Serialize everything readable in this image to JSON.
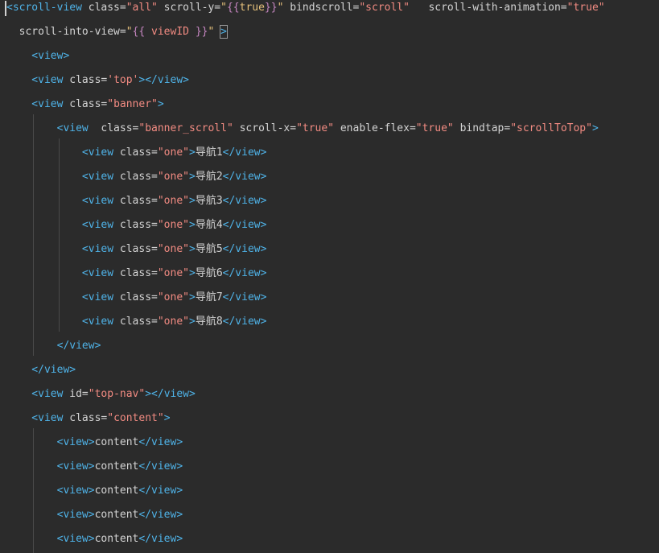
{
  "theme": {
    "background": "#2b2b2b",
    "tag": "#4fb3e8",
    "attribute": "#d4d4d4",
    "string": "#e5c07b",
    "string_value": "#f28b82",
    "text": "#d4d4d4",
    "moustache": "#c586c0",
    "guide": "#4a4a4a"
  },
  "code_lines": [
    [
      {
        "t": "<",
        "c": "tag"
      },
      {
        "t": "scroll-view",
        "c": "tag"
      },
      {
        "t": " class=",
        "c": "attribute"
      },
      {
        "t": "\"all\"",
        "c": "string_value"
      },
      {
        "t": " scroll-y=",
        "c": "attribute"
      },
      {
        "t": "\"",
        "c": "string"
      },
      {
        "t": "{{",
        "c": "moustache"
      },
      {
        "t": "true",
        "c": "string"
      },
      {
        "t": "}}",
        "c": "moustache"
      },
      {
        "t": "\"",
        "c": "string"
      },
      {
        "t": " bindscroll=",
        "c": "attribute"
      },
      {
        "t": "\"scroll\"",
        "c": "string_value"
      },
      {
        "t": "   scroll-with-animation=",
        "c": "attribute"
      },
      {
        "t": "\"true\"",
        "c": "string_value"
      }
    ],
    [
      {
        "t": "  scroll-into-view=",
        "c": "attribute"
      },
      {
        "t": "\"",
        "c": "string"
      },
      {
        "t": "{{",
        "c": "moustache"
      },
      {
        "t": " viewID ",
        "c": "string_value"
      },
      {
        "t": "}}",
        "c": "moustache"
      },
      {
        "t": "\"",
        "c": "string"
      },
      {
        "t": " ",
        "c": "attribute"
      },
      {
        "t": ">",
        "c": "tag",
        "box": true
      }
    ],
    [
      {
        "t": "    <view>",
        "c": "tag"
      }
    ],
    [
      {
        "t": "    <view",
        "c": "tag"
      },
      {
        "t": " class=",
        "c": "attribute"
      },
      {
        "t": "'top'",
        "c": "string_value"
      },
      {
        "t": "></view>",
        "c": "tag"
      }
    ],
    [
      {
        "t": "    <view",
        "c": "tag"
      },
      {
        "t": " class=",
        "c": "attribute"
      },
      {
        "t": "\"banner\"",
        "c": "string_value"
      },
      {
        "t": ">",
        "c": "tag"
      }
    ],
    [
      {
        "t": "        <view",
        "c": "tag"
      },
      {
        "t": "  class=",
        "c": "attribute"
      },
      {
        "t": "\"banner_scroll\"",
        "c": "string_value"
      },
      {
        "t": " scroll-x=",
        "c": "attribute"
      },
      {
        "t": "\"true\"",
        "c": "string_value"
      },
      {
        "t": " enable-flex=",
        "c": "attribute"
      },
      {
        "t": "\"true\"",
        "c": "string_value"
      },
      {
        "t": " bindtap=",
        "c": "attribute"
      },
      {
        "t": "\"scrollToTop\"",
        "c": "string_value"
      },
      {
        "t": ">",
        "c": "tag"
      }
    ],
    [
      {
        "t": "            <view",
        "c": "tag"
      },
      {
        "t": " class=",
        "c": "attribute"
      },
      {
        "t": "\"one\"",
        "c": "string_value"
      },
      {
        "t": ">",
        "c": "tag"
      },
      {
        "t": "导航1",
        "c": "text"
      },
      {
        "t": "</view>",
        "c": "tag"
      }
    ],
    [
      {
        "t": "            <view",
        "c": "tag"
      },
      {
        "t": " class=",
        "c": "attribute"
      },
      {
        "t": "\"one\"",
        "c": "string_value"
      },
      {
        "t": ">",
        "c": "tag"
      },
      {
        "t": "导航2",
        "c": "text"
      },
      {
        "t": "</view>",
        "c": "tag"
      }
    ],
    [
      {
        "t": "            <view",
        "c": "tag"
      },
      {
        "t": " class=",
        "c": "attribute"
      },
      {
        "t": "\"one\"",
        "c": "string_value"
      },
      {
        "t": ">",
        "c": "tag"
      },
      {
        "t": "导航3",
        "c": "text"
      },
      {
        "t": "</view>",
        "c": "tag"
      }
    ],
    [
      {
        "t": "            <view",
        "c": "tag"
      },
      {
        "t": " class=",
        "c": "attribute"
      },
      {
        "t": "\"one\"",
        "c": "string_value"
      },
      {
        "t": ">",
        "c": "tag"
      },
      {
        "t": "导航4",
        "c": "text"
      },
      {
        "t": "</view>",
        "c": "tag"
      }
    ],
    [
      {
        "t": "            <view",
        "c": "tag"
      },
      {
        "t": " class=",
        "c": "attribute"
      },
      {
        "t": "\"one\"",
        "c": "string_value"
      },
      {
        "t": ">",
        "c": "tag"
      },
      {
        "t": "导航5",
        "c": "text"
      },
      {
        "t": "</view>",
        "c": "tag"
      }
    ],
    [
      {
        "t": "            <view",
        "c": "tag"
      },
      {
        "t": " class=",
        "c": "attribute"
      },
      {
        "t": "\"one\"",
        "c": "string_value"
      },
      {
        "t": ">",
        "c": "tag"
      },
      {
        "t": "导航6",
        "c": "text"
      },
      {
        "t": "</view>",
        "c": "tag"
      }
    ],
    [
      {
        "t": "            <view",
        "c": "tag"
      },
      {
        "t": " class=",
        "c": "attribute"
      },
      {
        "t": "\"one\"",
        "c": "string_value"
      },
      {
        "t": ">",
        "c": "tag"
      },
      {
        "t": "导航7",
        "c": "text"
      },
      {
        "t": "</view>",
        "c": "tag"
      }
    ],
    [
      {
        "t": "            <view",
        "c": "tag"
      },
      {
        "t": " class=",
        "c": "attribute"
      },
      {
        "t": "\"one\"",
        "c": "string_value"
      },
      {
        "t": ">",
        "c": "tag"
      },
      {
        "t": "导航8",
        "c": "text"
      },
      {
        "t": "</view>",
        "c": "tag"
      }
    ],
    [
      {
        "t": "        </view>",
        "c": "tag"
      }
    ],
    [
      {
        "t": "    </view>",
        "c": "tag"
      }
    ],
    [
      {
        "t": "    <view",
        "c": "tag"
      },
      {
        "t": " id=",
        "c": "attribute"
      },
      {
        "t": "\"top-nav\"",
        "c": "string_value"
      },
      {
        "t": "></view>",
        "c": "tag"
      }
    ],
    [
      {
        "t": "    <view",
        "c": "tag"
      },
      {
        "t": " class=",
        "c": "attribute"
      },
      {
        "t": "\"content\"",
        "c": "string_value"
      },
      {
        "t": ">",
        "c": "tag"
      }
    ],
    [
      {
        "t": "        <view>",
        "c": "tag"
      },
      {
        "t": "content",
        "c": "text"
      },
      {
        "t": "</view>",
        "c": "tag"
      }
    ],
    [
      {
        "t": "        <view>",
        "c": "tag"
      },
      {
        "t": "content",
        "c": "text"
      },
      {
        "t": "</view>",
        "c": "tag"
      }
    ],
    [
      {
        "t": "        <view>",
        "c": "tag"
      },
      {
        "t": "content",
        "c": "text"
      },
      {
        "t": "</view>",
        "c": "tag"
      }
    ],
    [
      {
        "t": "        <view>",
        "c": "tag"
      },
      {
        "t": "content",
        "c": "text"
      },
      {
        "t": "</view>",
        "c": "tag"
      }
    ],
    [
      {
        "t": "        <view>",
        "c": "tag"
      },
      {
        "t": "content",
        "c": "text"
      },
      {
        "t": "</view>",
        "c": "tag"
      }
    ]
  ]
}
